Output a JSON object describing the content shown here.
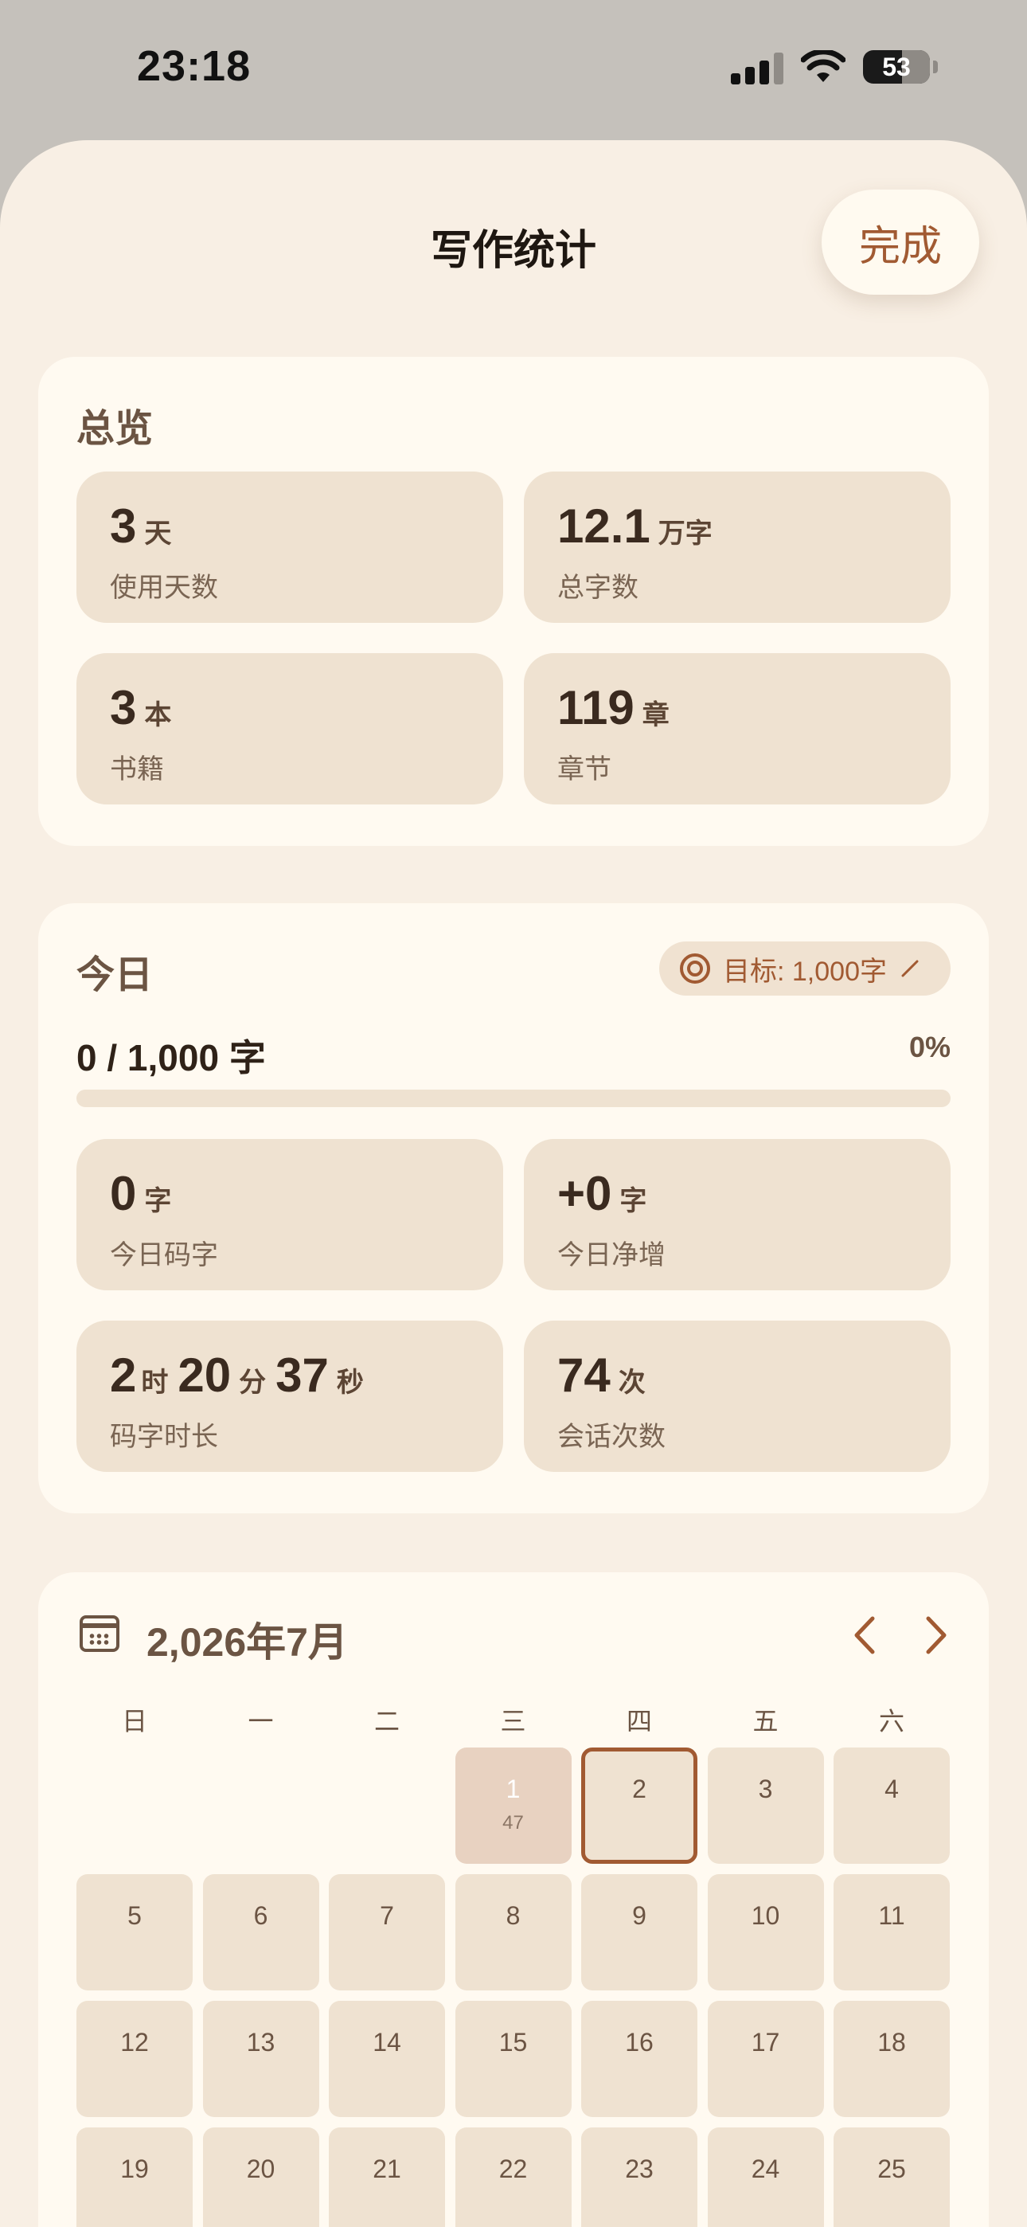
{
  "status_bar": {
    "time": "23:18",
    "battery": "53"
  },
  "header": {
    "title": "写作统计",
    "done_label": "完成"
  },
  "overview": {
    "title": "总览",
    "stats": [
      {
        "value": "3",
        "unit": "天",
        "label": "使用天数"
      },
      {
        "value": "12.1",
        "unit": "万字",
        "label": "总字数"
      },
      {
        "value": "3",
        "unit": "本",
        "label": "书籍"
      },
      {
        "value": "119",
        "unit": "章",
        "label": "章节"
      }
    ]
  },
  "today": {
    "title": "今日",
    "goal_label": "目标: 1,000字",
    "progress_text": "0 / 1,000 字",
    "progress_percent": "0%",
    "progress_fraction": 0,
    "stats": [
      {
        "value": "0",
        "unit": "字",
        "label": "今日码字"
      },
      {
        "value": "+0",
        "unit": "字",
        "label": "今日净增"
      },
      {
        "h": "2",
        "h_unit": "时",
        "m": "20",
        "m_unit": "分",
        "s": "37",
        "s_unit": "秒",
        "label": "码字时长"
      },
      {
        "value": "74",
        "unit": "次",
        "label": "会话次数"
      }
    ]
  },
  "calendar": {
    "month_label": "2,026年7月",
    "weekdays": [
      "日",
      "一",
      "二",
      "三",
      "四",
      "五",
      "六"
    ],
    "days": [
      {
        "day": "1",
        "words": "47"
      },
      {
        "day": "2"
      },
      {
        "day": "3"
      },
      {
        "day": "4"
      },
      {
        "day": "5"
      },
      {
        "day": "6"
      },
      {
        "day": "7"
      },
      {
        "day": "8"
      },
      {
        "day": "9"
      },
      {
        "day": "10"
      },
      {
        "day": "11"
      },
      {
        "day": "12"
      },
      {
        "day": "13"
      },
      {
        "day": "14"
      },
      {
        "day": "15"
      },
      {
        "day": "16"
      },
      {
        "day": "17"
      },
      {
        "day": "18"
      },
      {
        "day": "19"
      },
      {
        "day": "20"
      },
      {
        "day": "21"
      },
      {
        "day": "22"
      },
      {
        "day": "23"
      },
      {
        "day": "24"
      },
      {
        "day": "25"
      }
    ],
    "today_day": "2",
    "first_weekday_index": 3
  },
  "colors": {
    "accent": "#a15a32",
    "tile": "#efe2d1",
    "card": "#fffaf1",
    "sheet": "#f8efe4"
  },
  "icons": [
    "signal-icon",
    "wifi-icon",
    "battery-icon",
    "target-icon",
    "edit-icon",
    "calendar-icon",
    "chevron-left-icon",
    "chevron-right-icon"
  ]
}
